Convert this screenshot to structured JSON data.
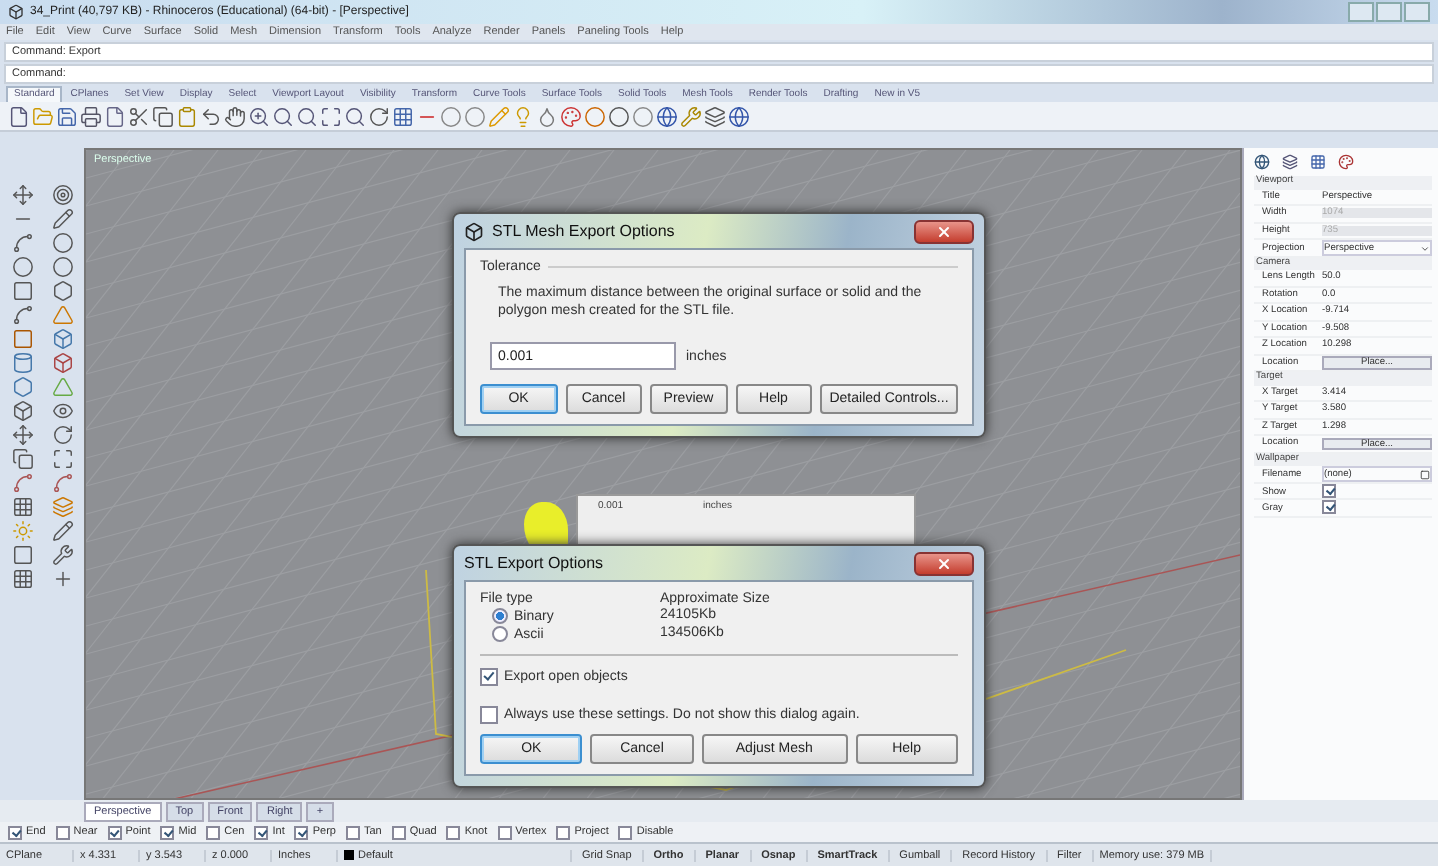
{
  "window": {
    "title": "34_Print (40,797 KB) - Rhinoceros (Educational) (64-bit) - [Perspective]"
  },
  "menu": [
    "File",
    "Edit",
    "View",
    "Curve",
    "Surface",
    "Solid",
    "Mesh",
    "Dimension",
    "Transform",
    "Tools",
    "Analyze",
    "Render",
    "Panels",
    "Paneling Tools",
    "Help"
  ],
  "command_history": "Command: Export",
  "command_prompt": "Command:",
  "toolbar_tabs": [
    {
      "label": "Standard",
      "selected": true
    },
    {
      "label": "CPlanes",
      "selected": false
    },
    {
      "label": "Set View",
      "selected": false
    },
    {
      "label": "Display",
      "selected": false
    },
    {
      "label": "Select",
      "selected": false
    },
    {
      "label": "Viewport Layout",
      "selected": false
    },
    {
      "label": "Visibility",
      "selected": false
    },
    {
      "label": "Transform",
      "selected": false
    },
    {
      "label": "Curve Tools",
      "selected": false
    },
    {
      "label": "Surface Tools",
      "selected": false
    },
    {
      "label": "Solid Tools",
      "selected": false
    },
    {
      "label": "Mesh Tools",
      "selected": false
    },
    {
      "label": "Render Tools",
      "selected": false
    },
    {
      "label": "Drafting",
      "selected": false
    },
    {
      "label": "New in V5",
      "selected": false
    }
  ],
  "viewport": {
    "label": "Perspective"
  },
  "mesh_dialog": {
    "title": "STL Mesh Export Options",
    "group": "Tolerance",
    "description": "The maximum distance between the original surface or solid and the polygon mesh created for the STL file.",
    "value": "0.001",
    "unit": "inches",
    "buttons": [
      {
        "label": "OK",
        "default": true
      },
      {
        "label": "Cancel",
        "default": false
      },
      {
        "label": "Preview",
        "default": false
      },
      {
        "label": "Help",
        "default": false
      },
      {
        "label": "Detailed Controls...",
        "default": false
      }
    ]
  },
  "ghost_dialog": {
    "value": "0.001",
    "unit": "inches"
  },
  "export_dialog": {
    "title": "STL Export Options",
    "col_type": "File type",
    "col_size": "Approximate Size",
    "types": [
      {
        "label": "Binary",
        "size": "24105Kb",
        "selected": true
      },
      {
        "label": "Ascii",
        "size": "134506Kb",
        "selected": false
      }
    ],
    "options": [
      {
        "label": "Export open objects",
        "checked": true
      },
      {
        "label": "Always use these settings. Do not show this dialog again.",
        "checked": false
      }
    ],
    "buttons": [
      {
        "label": "OK",
        "default": true
      },
      {
        "label": "Cancel",
        "default": false
      },
      {
        "label": "Adjust Mesh",
        "default": false
      },
      {
        "label": "Help",
        "default": false
      }
    ]
  },
  "properties": {
    "sections": [
      {
        "title": "Viewport",
        "rows": [
          {
            "label": "Title",
            "value": "Perspective",
            "kind": "text",
            "disabled": false
          },
          {
            "label": "Width",
            "value": "1074",
            "kind": "text",
            "disabled": true
          },
          {
            "label": "Height",
            "value": "735",
            "kind": "text",
            "disabled": true
          },
          {
            "label": "Projection",
            "value": "Perspective",
            "kind": "dropdown"
          }
        ]
      },
      {
        "title": "Camera",
        "rows": [
          {
            "label": "Lens Length",
            "value": "50.0",
            "kind": "text",
            "disabled": false
          },
          {
            "label": "Rotation",
            "value": "0.0",
            "kind": "text",
            "disabled": false
          },
          {
            "label": "X Location",
            "value": "-9.714",
            "kind": "text",
            "disabled": false
          },
          {
            "label": "Y Location",
            "value": "-9.508",
            "kind": "text",
            "disabled": false
          },
          {
            "label": "Z Location",
            "value": "10.298",
            "kind": "text",
            "disabled": false
          },
          {
            "label": "Location",
            "value": "Place...",
            "kind": "button"
          }
        ]
      },
      {
        "title": "Target",
        "rows": [
          {
            "label": "X Target",
            "value": "3.414",
            "kind": "text",
            "disabled": false
          },
          {
            "label": "Y Target",
            "value": "3.580",
            "kind": "text",
            "disabled": false
          },
          {
            "label": "Z Target",
            "value": "1.298",
            "kind": "text",
            "disabled": false
          },
          {
            "label": "Location",
            "value": "Place...",
            "kind": "button"
          }
        ]
      },
      {
        "title": "Wallpaper",
        "rows": [
          {
            "label": "Filename",
            "value": "(none)",
            "kind": "file"
          },
          {
            "label": "Show",
            "checked": true,
            "kind": "check"
          },
          {
            "label": "Gray",
            "checked": true,
            "kind": "check"
          }
        ]
      }
    ]
  },
  "viewport_tabs": [
    {
      "label": "Perspective",
      "selected": true
    },
    {
      "label": "Top",
      "selected": false
    },
    {
      "label": "Front",
      "selected": false
    },
    {
      "label": "Right",
      "selected": false
    },
    {
      "label": "+",
      "selected": false
    }
  ],
  "osnaps": [
    {
      "label": "End",
      "checked": true
    },
    {
      "label": "Near",
      "checked": false
    },
    {
      "label": "Point",
      "checked": true
    },
    {
      "label": "Mid",
      "checked": true
    },
    {
      "label": "Cen",
      "checked": false
    },
    {
      "label": "Int",
      "checked": true
    },
    {
      "label": "Perp",
      "checked": true
    },
    {
      "label": "Tan",
      "checked": false
    },
    {
      "label": "Quad",
      "checked": false
    },
    {
      "label": "Knot",
      "checked": false
    },
    {
      "label": "Vertex",
      "checked": false
    },
    {
      "label": "Project",
      "checked": false
    },
    {
      "label": "Disable",
      "checked": false
    }
  ],
  "status_bar": [
    {
      "text": "CPlane",
      "kind": "text"
    },
    {
      "text": "x 4.331",
      "kind": "text"
    },
    {
      "text": "y 3.543",
      "kind": "text"
    },
    {
      "text": "z 0.000",
      "kind": "text"
    },
    {
      "text": "Inches",
      "kind": "text"
    },
    {
      "text": "Default",
      "kind": "layer"
    },
    {
      "text": "Grid Snap",
      "kind": "pane",
      "on": false
    },
    {
      "text": "Ortho",
      "kind": "pane",
      "on": true
    },
    {
      "text": "Planar",
      "kind": "pane",
      "on": true
    },
    {
      "text": "Osnap",
      "kind": "pane",
      "on": true
    },
    {
      "text": "SmartTrack",
      "kind": "pane",
      "on": true
    },
    {
      "text": "Gumball",
      "kind": "pane",
      "on": false
    },
    {
      "text": "Record History",
      "kind": "pane",
      "on": false
    },
    {
      "text": "Filter",
      "kind": "pane",
      "on": false
    },
    {
      "text": "Memory use: 379 MB",
      "kind": "text"
    }
  ]
}
